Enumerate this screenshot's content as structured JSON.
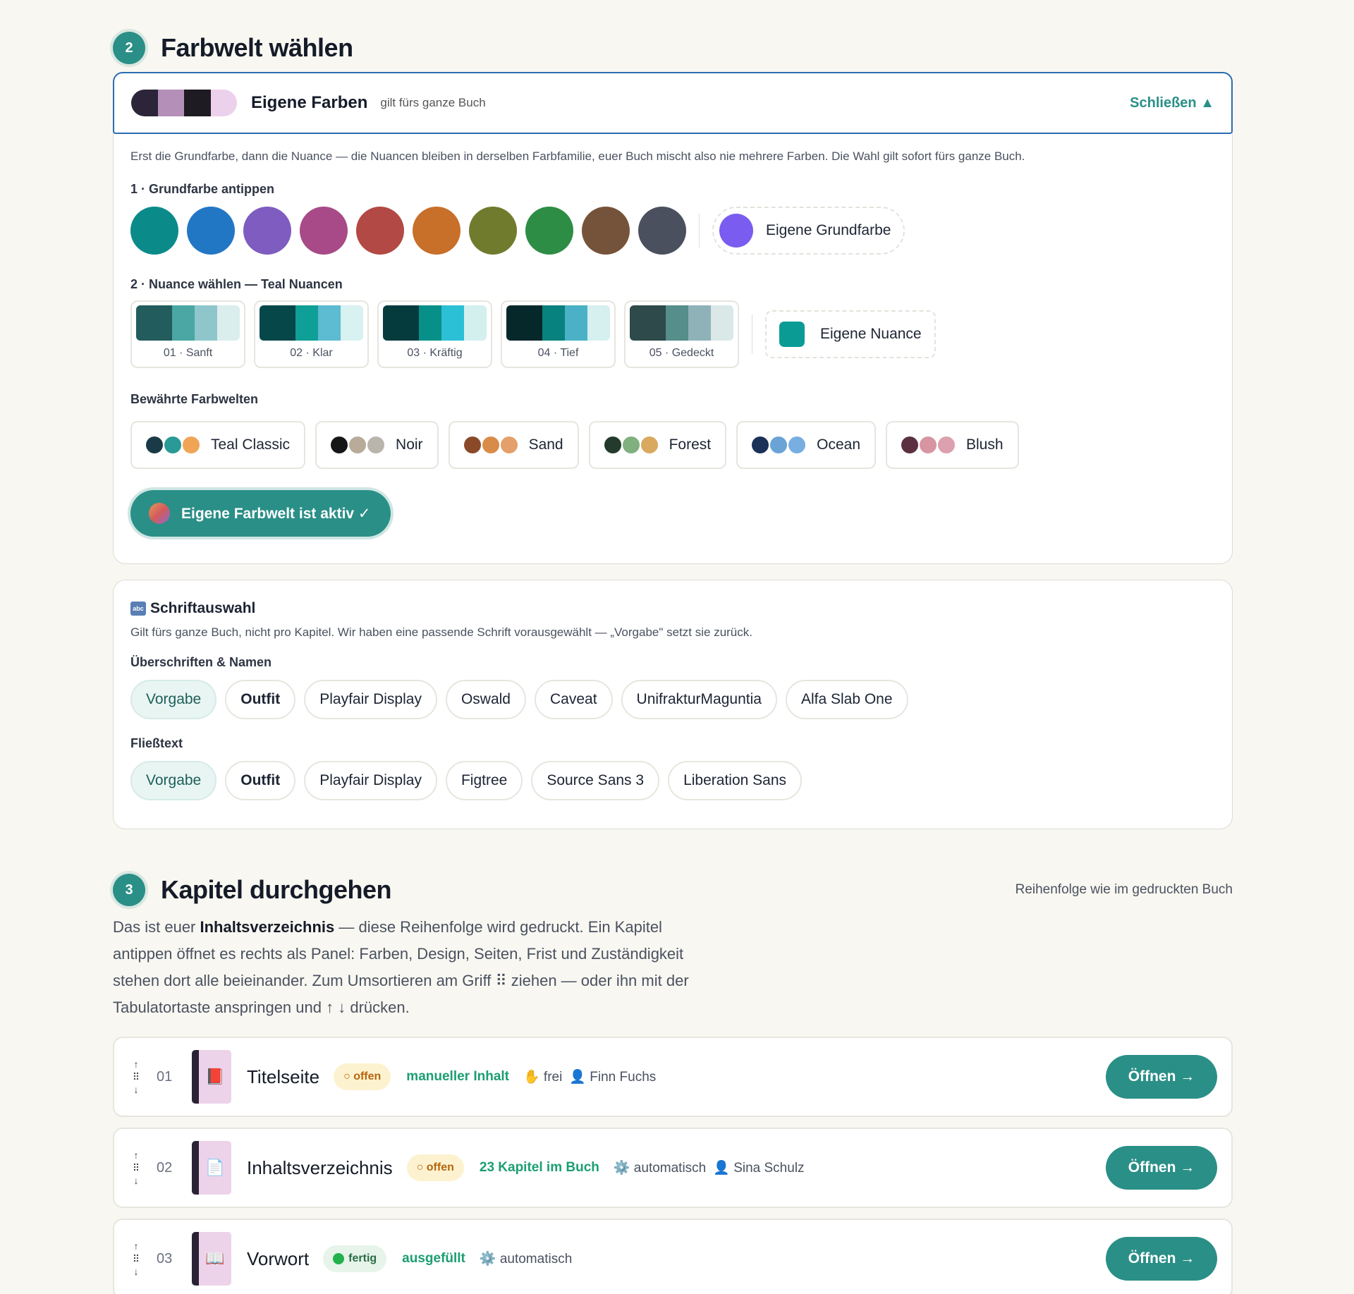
{
  "section2": {
    "number": "2",
    "title": "Farbwelt wählen",
    "header": {
      "swatch_colors": [
        "#2c2438",
        "#b48fb8",
        "#1e1b22",
        "#ecd1ec"
      ],
      "title": "Eigene Farben",
      "subtitle": "gilt fürs ganze Buch",
      "close": "Schließen ▲"
    },
    "description": "Erst die Grundfarbe, dann die Nuance — die Nuancen bleiben in derselben Farbfamilie, euer Buch mischt also nie mehrere Farben. Die Wahl gilt sofort fürs ganze Buch.",
    "base_label": "1 · Grundfarbe antippen",
    "base_colors": [
      "#0b8a8a",
      "#2277c4",
      "#7e5cc0",
      "#a84a88",
      "#b24944",
      "#c86f2a",
      "#707b2e",
      "#2e8d45",
      "#75533a",
      "#4a505e"
    ],
    "custom_base": {
      "label": "Eigene Grundfarbe",
      "color": "#7b5cf0"
    },
    "nuance_label": "2 · Nuance wählen — Teal Nuancen",
    "nuances": [
      {
        "label": "01 · Sanft",
        "colors": [
          "#235c5c",
          "#4aa7a3",
          "#8fc6cc",
          "#dbeeee"
        ]
      },
      {
        "label": "02 · Klar",
        "colors": [
          "#06474a",
          "#0e9f96",
          "#5dbbd2",
          "#d8f1f1"
        ]
      },
      {
        "label": "03 · Kräftig",
        "colors": [
          "#063b3e",
          "#069088",
          "#2cc0d6",
          "#d3f0ef"
        ]
      },
      {
        "label": "04 · Tief",
        "colors": [
          "#06282b",
          "#07827e",
          "#4ab1c6",
          "#d6efef"
        ]
      },
      {
        "label": "05 · Gedeckt",
        "colors": [
          "#2e4a4b",
          "#558e8a",
          "#8fb2b9",
          "#dae8e8"
        ]
      }
    ],
    "custom_nuance": {
      "label": "Eigene Nuance",
      "color": "#0b9b95"
    },
    "presets_label": "Bewährte Farbwelten",
    "presets": [
      {
        "label": "Teal Classic",
        "dots": [
          "#1b3a47",
          "#2a9a96",
          "#f0a456"
        ]
      },
      {
        "label": "Noir",
        "dots": [
          "#161616",
          "#b8ab9a",
          "#b9b5ad"
        ]
      },
      {
        "label": "Sand",
        "dots": [
          "#8a4a2a",
          "#d98c4a",
          "#e4a06a"
        ]
      },
      {
        "label": "Forest",
        "dots": [
          "#233a2c",
          "#7fb07e",
          "#d8a95e"
        ]
      },
      {
        "label": "Ocean",
        "dots": [
          "#1a3158",
          "#6aa3d6",
          "#78aee0"
        ]
      },
      {
        "label": "Blush",
        "dots": [
          "#5b3040",
          "#d795a2",
          "#dca0ae"
        ]
      }
    ],
    "active_button": "Eigene Farbwelt ist aktiv ✓"
  },
  "fonts": {
    "icon": "abc",
    "title": "Schriftauswahl",
    "description": "Gilt fürs ganze Buch, nicht pro Kapitel. Wir haben eine passende Schrift vorausgewählt — „Vorgabe\" setzt sie zurück.",
    "headings_label": "Überschriften & Namen",
    "headings": [
      "Vorgabe",
      "Outfit",
      "Playfair Display",
      "Oswald",
      "Caveat",
      "UnifrakturMaguntia",
      "Alfa Slab One"
    ],
    "body_label": "Fließtext",
    "body": [
      "Vorgabe",
      "Outfit",
      "Playfair Display",
      "Figtree",
      "Source Sans 3",
      "Liberation Sans"
    ]
  },
  "section3": {
    "number": "3",
    "title": "Kapitel durchgehen",
    "order_note": "Reihenfolge wie im gedruckten Buch",
    "intro_1": "Das ist euer ",
    "intro_bold": "Inhaltsverzeichnis",
    "intro_2": " — diese Reihenfolge wird gedruckt. Ein Kapitel antippen öffnet es rechts als Panel: Farben, Design, Seiten, Frist und Zuständigkeit stehen dort alle beieinander. Zum Umsortieren am Griff ⠿ ziehen — oder ihn mit der Tabulatortaste anspringen und ↑ ↓ drücken.",
    "chapters": [
      {
        "num": "01",
        "icon": "📕",
        "title": "Titelseite",
        "status": "○ offen",
        "info": "manueller Inhalt",
        "mode": "✋ frei",
        "person": "👤 Finn Fuchs",
        "button": "Öffnen →"
      },
      {
        "num": "02",
        "icon": "📄",
        "title": "Inhaltsverzeichnis",
        "status": "○ offen",
        "info": "23 Kapitel im Buch",
        "mode": "⚙️ automatisch",
        "person": "👤 Sina Schulz",
        "button": "Öffnen →"
      },
      {
        "num": "03",
        "icon": "📖",
        "title": "Vorwort",
        "status": "fertig",
        "info": "ausgefüllt",
        "mode": "⚙️ automatisch",
        "person": "",
        "button": "Öffnen →"
      }
    ]
  }
}
